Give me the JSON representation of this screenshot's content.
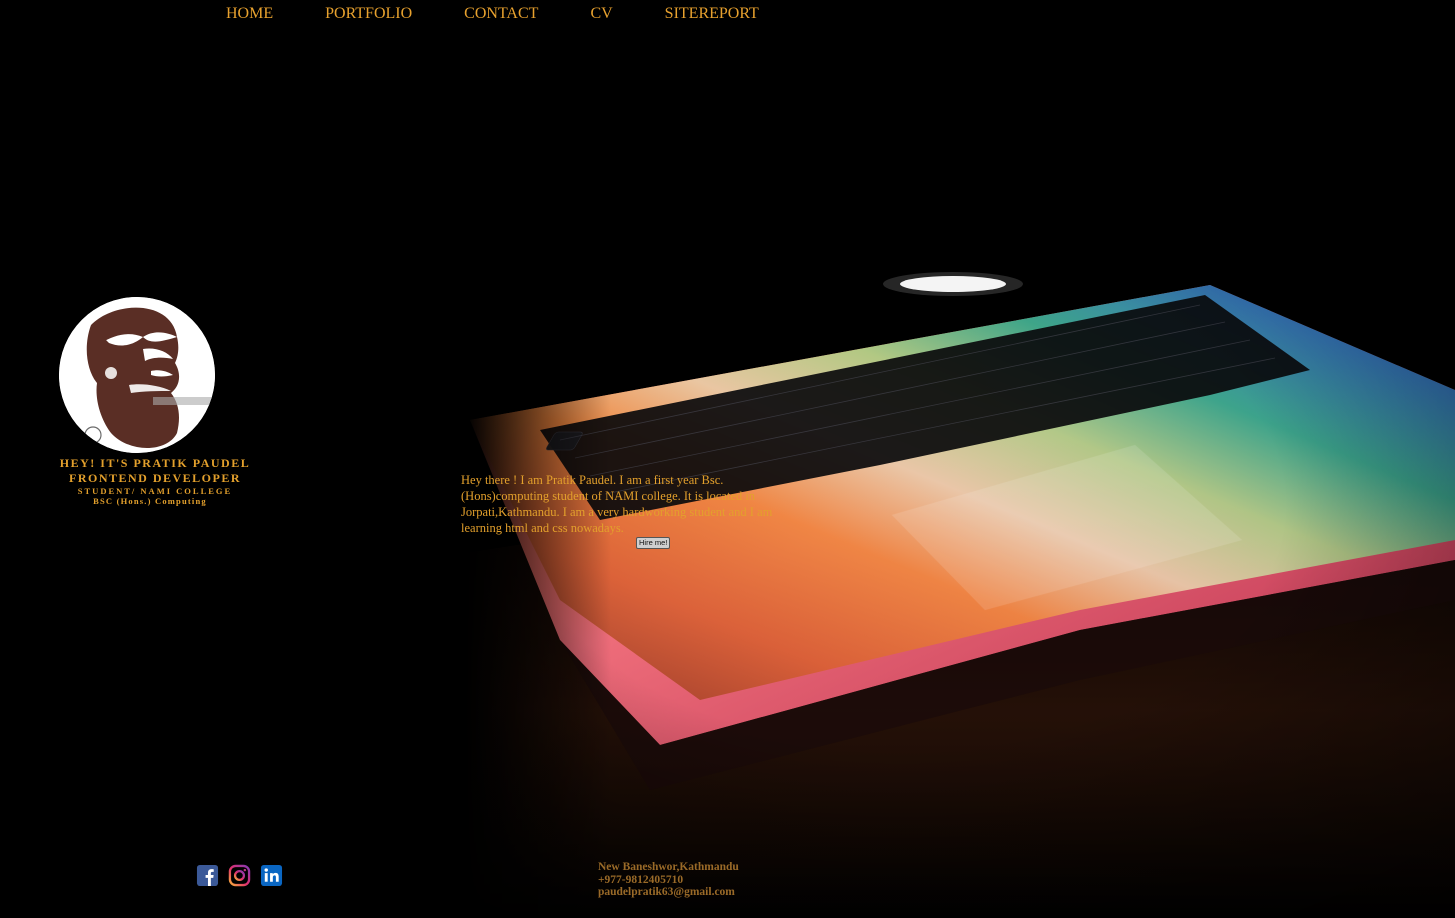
{
  "nav": {
    "items": [
      "HOME",
      "PORTFOLIO",
      "CONTACT",
      "CV",
      "SITEREPORT"
    ]
  },
  "profile": {
    "avatar_icon": "bearded-man-logo",
    "greeting": "HEY! IT'S PRATIK PAUDEL",
    "role": "FRONTEND DEVELOPER",
    "school": "STUDENT/ NAMI COLLEGE",
    "degree": "BSC (Hons.) Computing"
  },
  "intro": {
    "text": "Hey there ! I am Pratik Paudel. I am a first year Bsc.(Hons)computing student of NAMI college. It is located in Jorpati,Kathmandu. I am a very hardworking student and I am learning html and css nowadays.",
    "button_label": "Hire me!"
  },
  "social": [
    {
      "icon": "facebook-icon",
      "color": "#3b5998"
    },
    {
      "icon": "instagram-icon",
      "color": "#c13584"
    },
    {
      "icon": "linkedin-icon",
      "color": "#0a66c2"
    }
  ],
  "contact": {
    "address": "New Baneshwor,Kathmandu",
    "phone": "+977-9812405710",
    "email": "paudelpratik63@gmail.com"
  },
  "colors": {
    "accent": "#e3a02c",
    "background": "#000000"
  }
}
